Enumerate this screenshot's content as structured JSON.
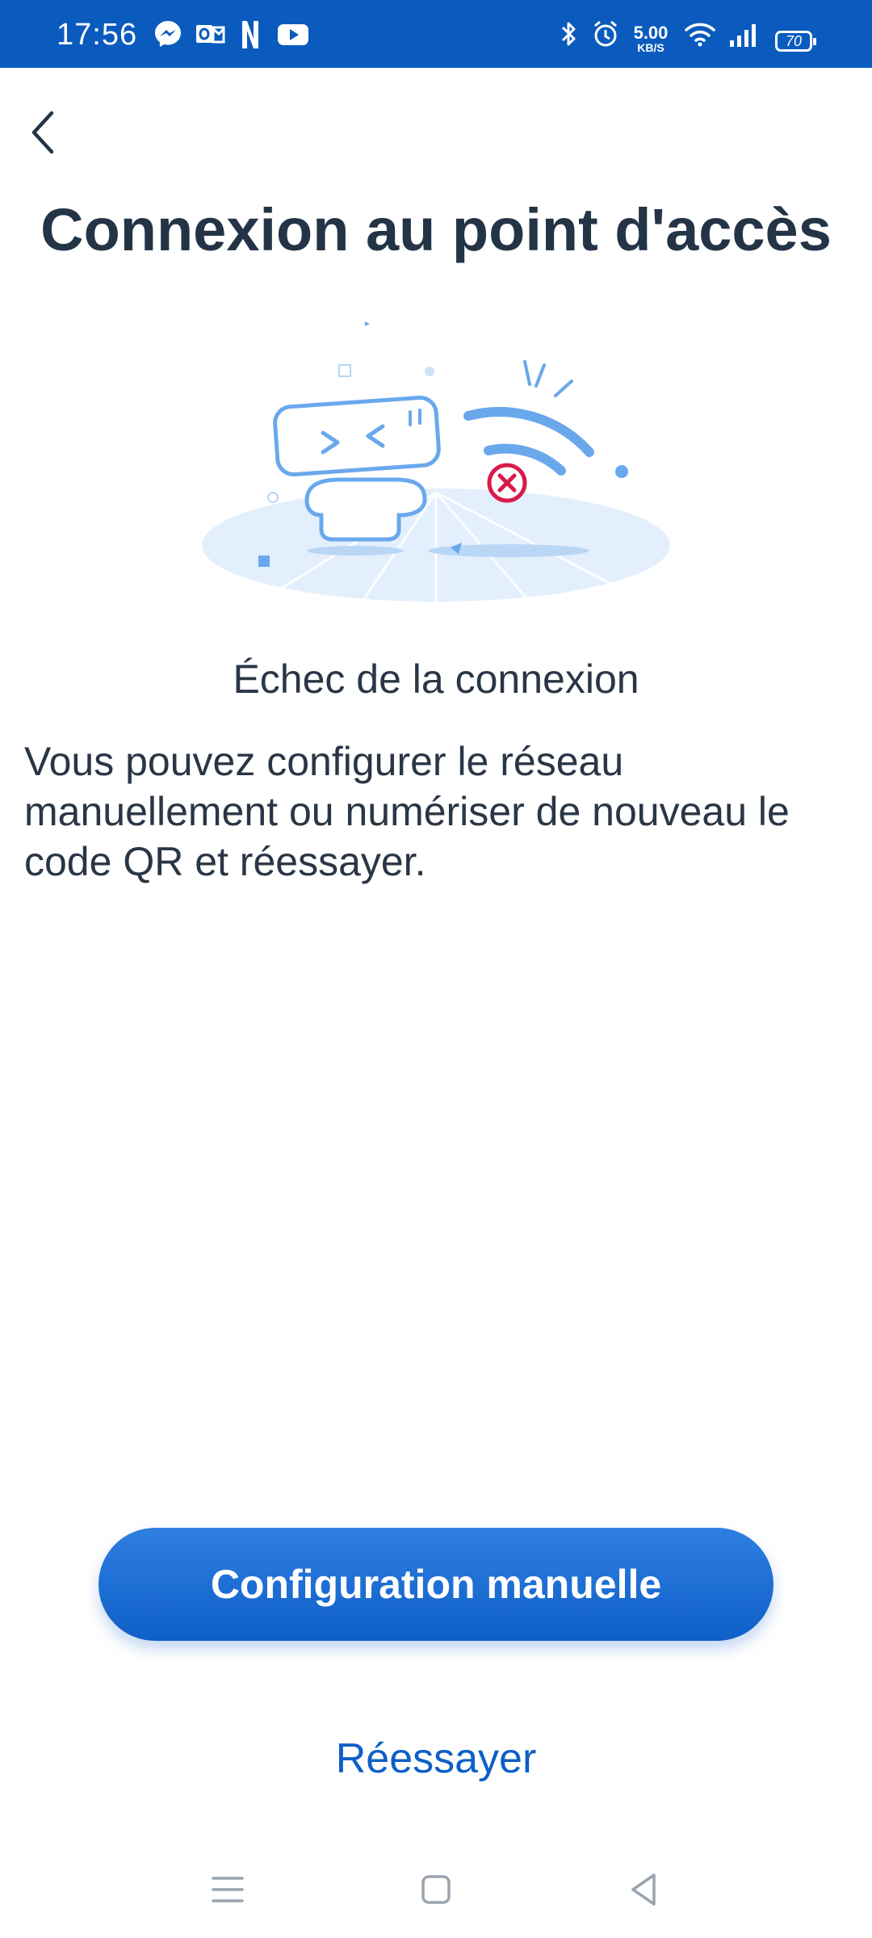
{
  "status_bar": {
    "time": "17:56",
    "net_speed_value": "5.00",
    "net_speed_unit": "KB/S",
    "battery_level": "70",
    "notification_icons": [
      "messenger-icon",
      "outlook-icon",
      "netflix-icon",
      "youtube-icon"
    ],
    "system_icons": [
      "bluetooth-icon",
      "alarm-icon",
      "wifi-icon",
      "signal-icon",
      "battery-icon"
    ]
  },
  "header": {
    "back_icon": "chevron-left-icon",
    "title": "Connexion au point d'accès"
  },
  "content": {
    "status_heading": "Échec de la connexion",
    "description": "Vous pouvez configurer le réseau manuellement ou numériser de nouveau le code QR et réessayer."
  },
  "actions": {
    "primary_label": "Configuration manuelle",
    "secondary_label": "Réessayer"
  },
  "navigation": {
    "buttons": [
      "menu-icon",
      "home-icon",
      "back-icon"
    ]
  },
  "colors": {
    "status_bar": "#0a5bbd",
    "primary": "#1565c0",
    "text": "#243447",
    "error": "#d81b4a",
    "illustration": "#6aa8ec"
  }
}
